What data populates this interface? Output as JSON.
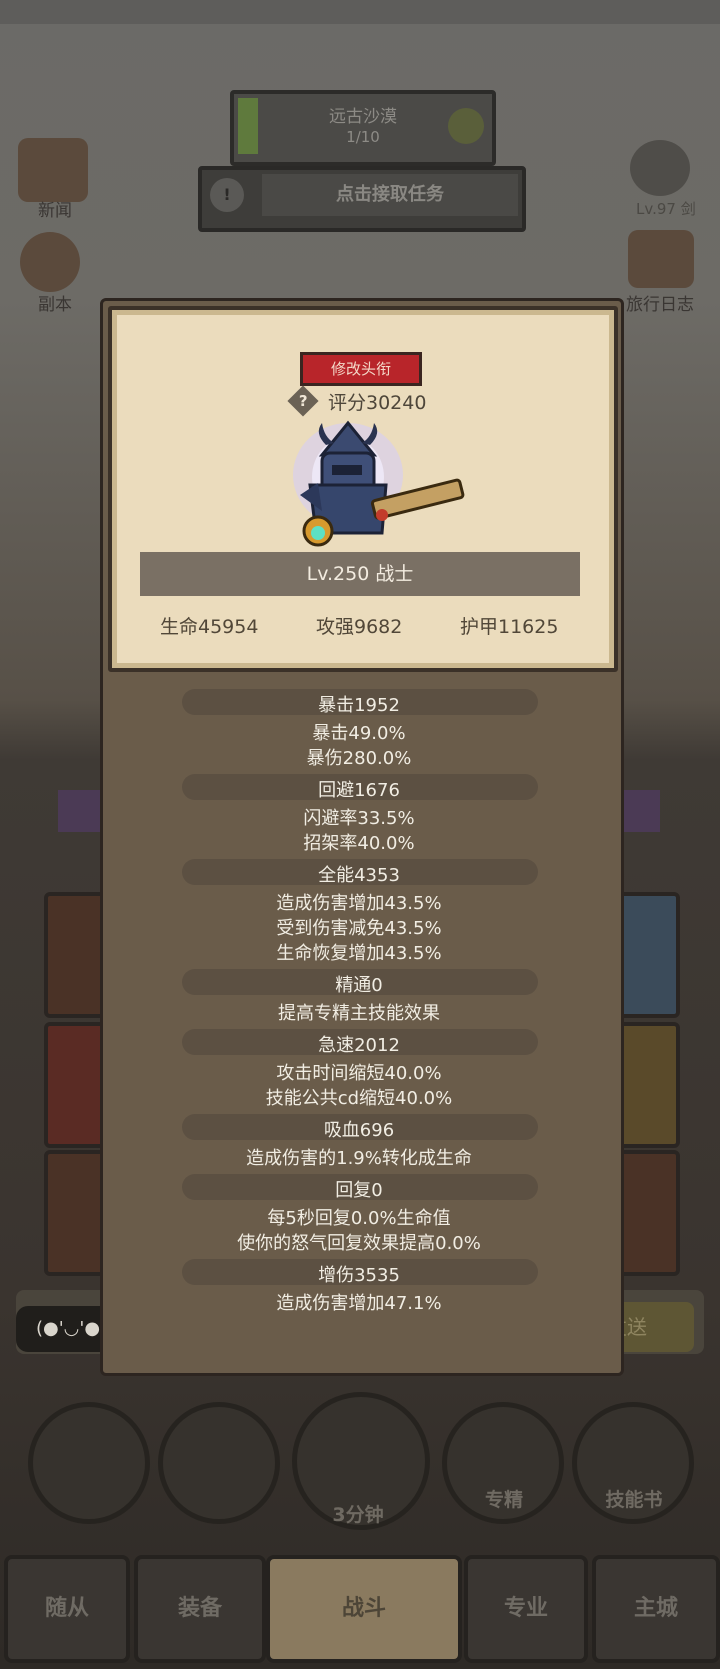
{
  "hud": {
    "region_name": "远古沙漠",
    "region_progress": "1/10",
    "task_button": "点击接取任务",
    "side_left": [
      "新闻",
      "副本"
    ],
    "side_right": [
      "旅行日志"
    ],
    "right_text": "Lv.97 剑",
    "chat_text": "(●'◡'●",
    "send_button": "发送"
  },
  "actions": {
    "timer": "3分钟",
    "specialize": "专精",
    "skill_book": "技能书"
  },
  "tabs": [
    "随从",
    "装备",
    "战斗",
    "专业",
    "主城"
  ],
  "popup": {
    "edit_title_button": "修改头衔",
    "score": "评分30240",
    "level_class": "Lv.250 战士",
    "hp": "生命45954",
    "attack": "攻强9682",
    "armor": "护甲11625",
    "stats": [
      {
        "header": "暴击1952",
        "lines": [
          "暴击49.0%",
          "暴伤280.0%"
        ]
      },
      {
        "header": "回避1676",
        "lines": [
          "闪避率33.5%",
          "招架率40.0%"
        ]
      },
      {
        "header": "全能4353",
        "lines": [
          "造成伤害增加43.5%",
          "受到伤害减免43.5%",
          "生命恢复增加43.5%"
        ]
      },
      {
        "header": "精通0",
        "lines": [
          "提高专精主技能效果"
        ]
      },
      {
        "header": "急速2012",
        "lines": [
          "攻击时间缩短40.0%",
          "技能公共cd缩短40.0%"
        ]
      },
      {
        "header": "吸血696",
        "lines": [
          "造成伤害的1.9%转化成生命"
        ]
      },
      {
        "header": "回复0",
        "lines": [
          "每5秒回复0.0%生命值",
          "使你的怒气回复效果提高0.0%"
        ]
      },
      {
        "header": "增伤3535",
        "lines": [
          "造成伤害增加47.1%"
        ]
      }
    ]
  }
}
